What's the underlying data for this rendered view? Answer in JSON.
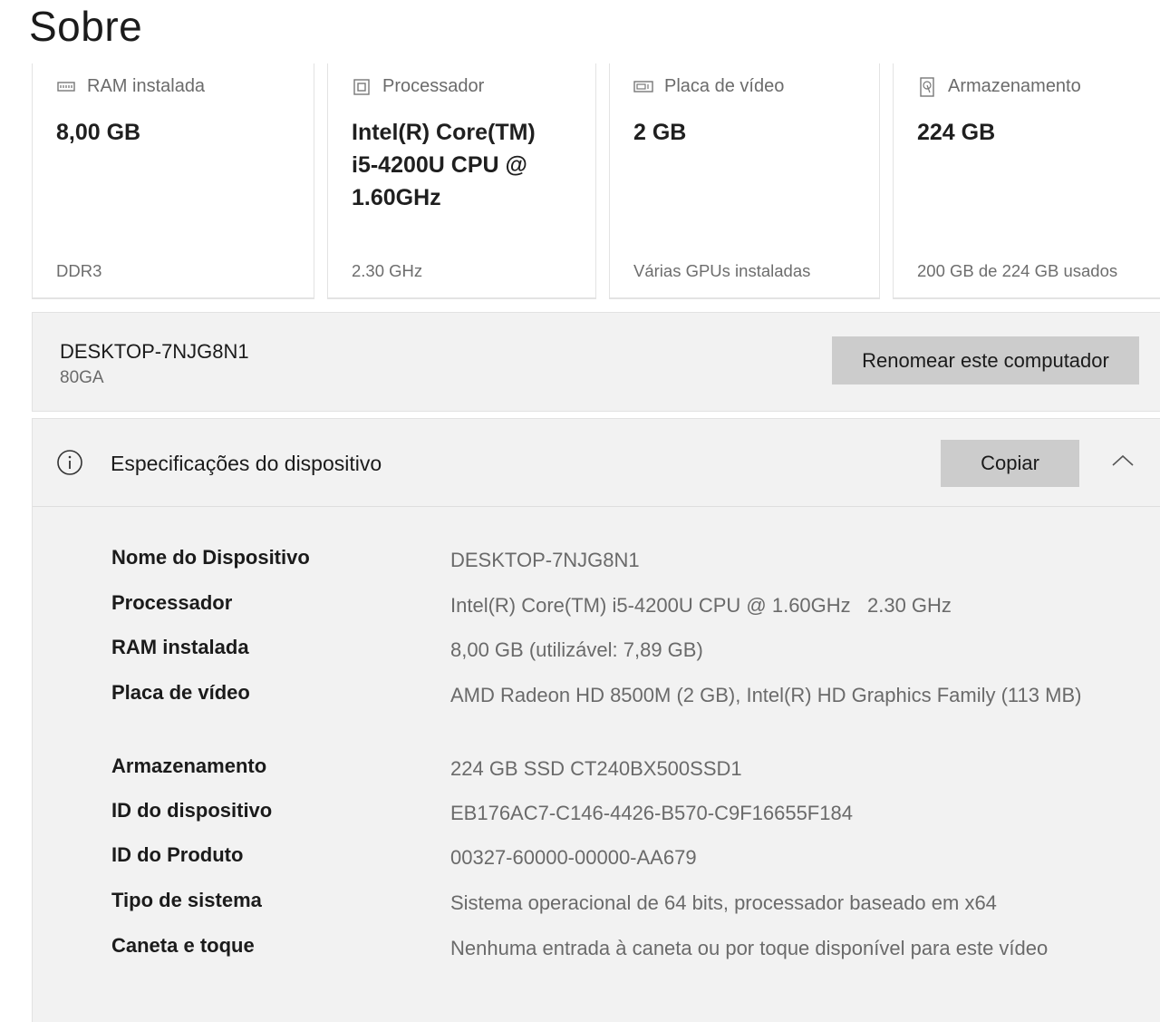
{
  "page": {
    "title": "Sobre"
  },
  "cards": [
    {
      "icon": "ram-icon",
      "label": "RAM instalada",
      "value": "8,00 GB",
      "sub": "DDR3"
    },
    {
      "icon": "processor-icon",
      "label": "Processador",
      "value": "Intel(R) Core(TM) i5-4200U CPU @ 1.60GHz",
      "sub": "2.30 GHz"
    },
    {
      "icon": "video-card-icon",
      "label": "Placa de vídeo",
      "value": "2 GB",
      "sub": "Várias GPUs instaladas"
    },
    {
      "icon": "storage-icon",
      "label": "Armazenamento",
      "value": "224 GB",
      "sub": "200 GB de 224 GB usados"
    }
  ],
  "device": {
    "name": "DESKTOP-7NJG8N1",
    "model": "80GA",
    "rename_label": "Renomear este computador"
  },
  "specs": {
    "title": "Especificações do dispositivo",
    "copy_label": "Copiar",
    "rows": [
      {
        "key": "Nome do Dispositivo",
        "value": "DESKTOP-7NJG8N1"
      },
      {
        "key": "Processador",
        "value": "Intel(R) Core(TM) i5-4200U CPU @ 1.60GHz   2.30 GHz"
      },
      {
        "key": "RAM instalada",
        "value": "8,00 GB (utilizável: 7,89 GB)"
      },
      {
        "key": "Placa de vídeo",
        "value": "AMD Radeon HD 8500M (2 GB), Intel(R) HD Graphics Family (113 MB)"
      },
      {
        "key": "Armazenamento",
        "value": "224 GB SSD CT240BX500SSD1"
      },
      {
        "key": "ID do dispositivo",
        "value": "EB176AC7-C146-4426-B570-C9F16655F184"
      },
      {
        "key": "ID do Produto",
        "value": "00327-60000-00000-AA679"
      },
      {
        "key": "Tipo de sistema",
        "value": "Sistema operacional de 64 bits, processador baseado em x64"
      },
      {
        "key": "Caneta e toque",
        "value": "Nenhuma entrada à caneta ou por toque disponível para este vídeo"
      }
    ]
  }
}
